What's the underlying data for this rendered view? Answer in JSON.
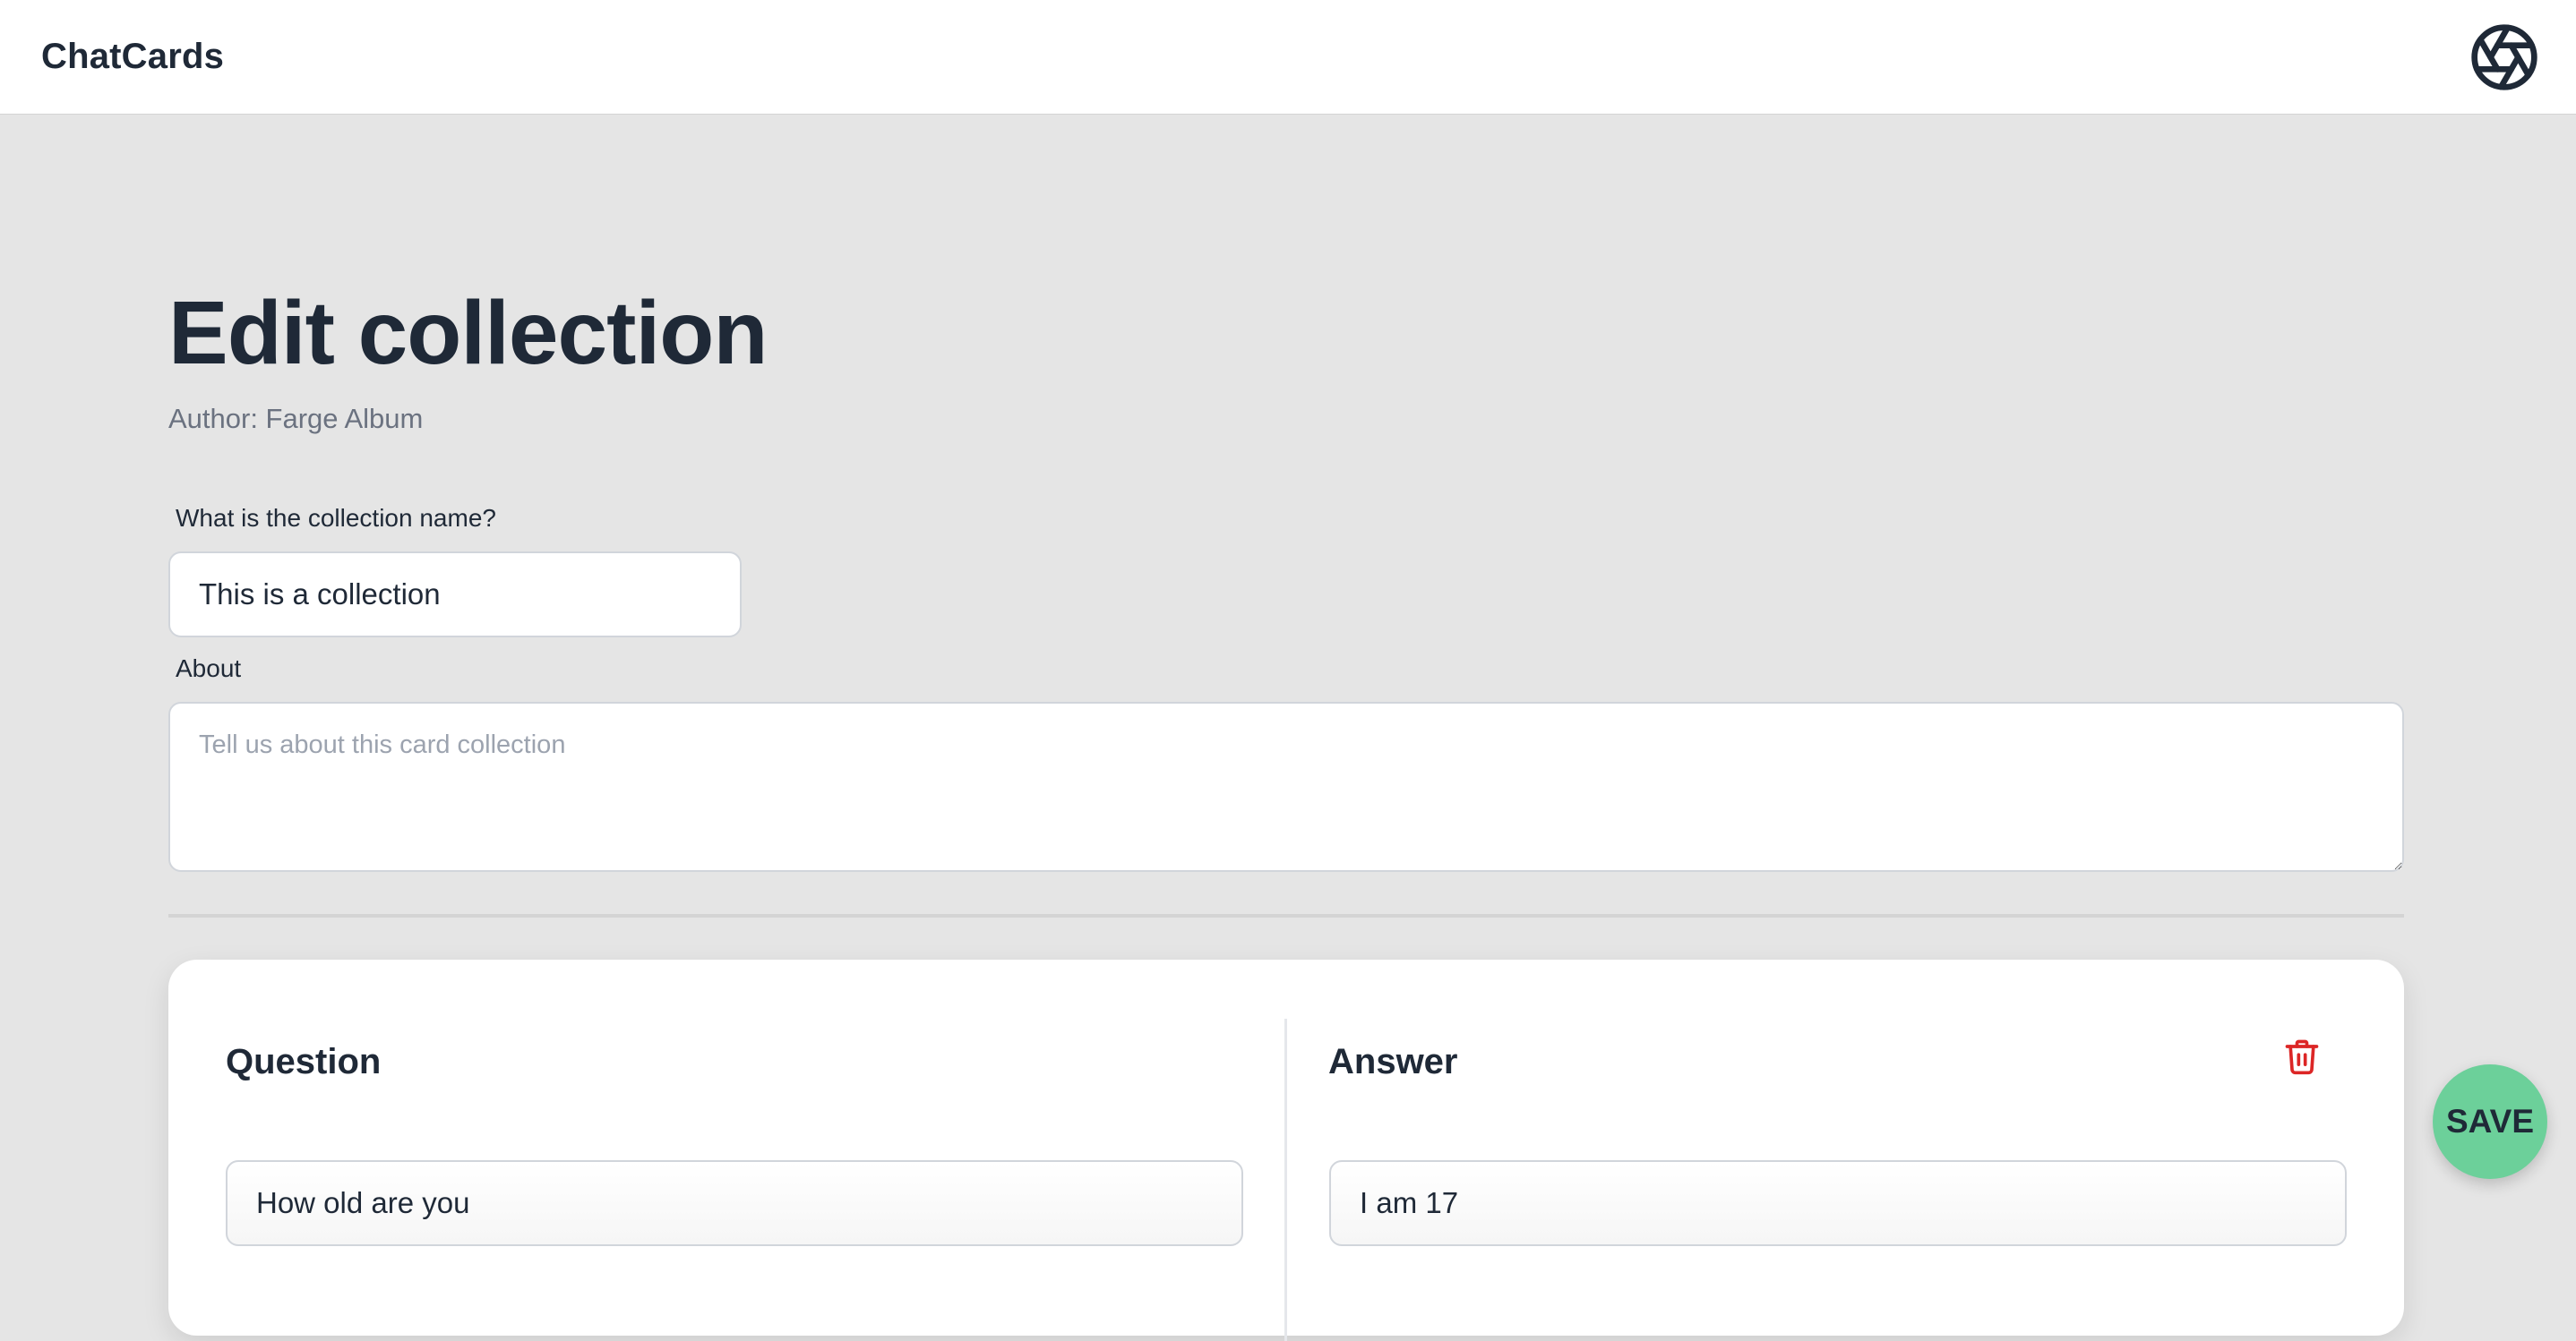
{
  "header": {
    "brand": "ChatCards",
    "logo_icon": "aperture-icon"
  },
  "page": {
    "title": "Edit collection",
    "author_label": "Author: Farge Album"
  },
  "form": {
    "name_label": "What is the collection name?",
    "name_value": "This is a collection",
    "about_label": "About",
    "about_value": "",
    "about_placeholder": "Tell us about this card collection"
  },
  "card": {
    "question_title": "Question",
    "answer_title": "Answer",
    "question_value": "How old are you",
    "answer_value": "I am 17",
    "delete_icon": "trash-icon"
  },
  "actions": {
    "save_label": "SAVE"
  },
  "colors": {
    "background": "#e5e5e5",
    "save_button": "#6cd09a",
    "delete_icon": "#dc2626",
    "text_primary": "#1f2937",
    "text_muted": "#6b7280"
  }
}
